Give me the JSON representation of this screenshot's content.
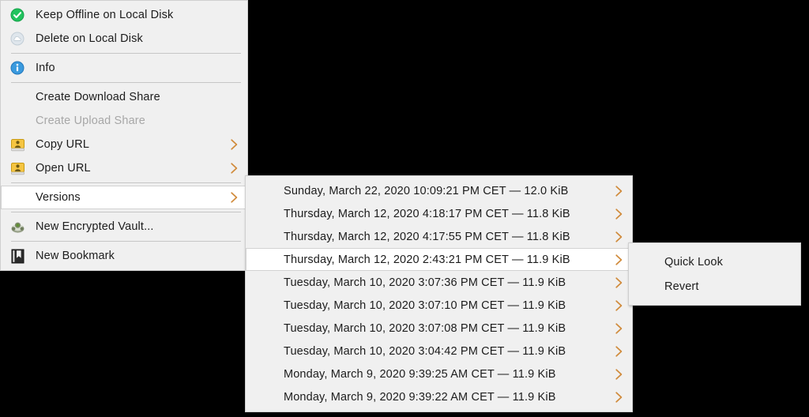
{
  "colors": {
    "menu_background": "#f0f0f0",
    "menu_border": "#cfcfcf",
    "highlight_background": "#ffffff",
    "text": "#1c1c1c",
    "disabled_text": "#a7a7a7",
    "separator": "#c6c6c6",
    "chevron": "#d08a3a",
    "check_green": "#22c35e",
    "info_blue": "#3a9ade",
    "share_yellow": "#f5c542",
    "desktop": "#000000"
  },
  "main_menu": {
    "items": [
      {
        "label": "Keep Offline on Local Disk",
        "icon": "green-check-icon",
        "type": "item",
        "disabled": false,
        "submenu": false,
        "highlighted": false
      },
      {
        "label": "Delete on Local Disk",
        "icon": "cloud-icon",
        "type": "item",
        "disabled": false,
        "submenu": false,
        "highlighted": false
      },
      {
        "type": "separator"
      },
      {
        "label": "Info",
        "icon": "info-icon",
        "type": "item",
        "disabled": false,
        "submenu": false,
        "highlighted": false
      },
      {
        "type": "separator"
      },
      {
        "label": "Create Download Share",
        "icon": "none",
        "type": "item",
        "disabled": false,
        "submenu": false,
        "highlighted": false
      },
      {
        "label": "Create Upload Share",
        "icon": "none",
        "type": "item",
        "disabled": true,
        "submenu": false,
        "highlighted": false
      },
      {
        "label": "Copy URL",
        "icon": "share-disk-icon",
        "type": "item",
        "disabled": false,
        "submenu": true,
        "highlighted": false
      },
      {
        "label": "Open URL",
        "icon": "share-disk-icon",
        "type": "item",
        "disabled": false,
        "submenu": true,
        "highlighted": false
      },
      {
        "type": "separator"
      },
      {
        "label": "Versions",
        "icon": "none",
        "type": "item",
        "disabled": false,
        "submenu": true,
        "highlighted": true
      },
      {
        "type": "separator"
      },
      {
        "label": "New Encrypted Vault...",
        "icon": "vault-icon",
        "type": "item",
        "disabled": false,
        "submenu": false,
        "highlighted": false
      },
      {
        "type": "separator"
      },
      {
        "label": "New Bookmark",
        "icon": "bookmark-icon",
        "type": "item",
        "disabled": false,
        "submenu": false,
        "highlighted": false
      }
    ]
  },
  "versions_menu": {
    "items": [
      {
        "label": "Sunday, March 22, 2020 10:09:21 PM CET — 12.0 KiB",
        "submenu": true,
        "highlighted": false
      },
      {
        "label": "Thursday, March 12, 2020 4:18:17 PM CET — 11.8 KiB",
        "submenu": true,
        "highlighted": false
      },
      {
        "label": "Thursday, March 12, 2020 4:17:55 PM CET — 11.8 KiB",
        "submenu": true,
        "highlighted": false
      },
      {
        "label": "Thursday, March 12, 2020 2:43:21 PM CET — 11.9 KiB",
        "submenu": true,
        "highlighted": true
      },
      {
        "label": "Tuesday, March 10, 2020 3:07:36 PM CET — 11.9 KiB",
        "submenu": true,
        "highlighted": false
      },
      {
        "label": "Tuesday, March 10, 2020 3:07:10 PM CET — 11.9 KiB",
        "submenu": true,
        "highlighted": false
      },
      {
        "label": "Tuesday, March 10, 2020 3:07:08 PM CET — 11.9 KiB",
        "submenu": true,
        "highlighted": false
      },
      {
        "label": "Tuesday, March 10, 2020 3:04:42 PM CET — 11.9 KiB",
        "submenu": true,
        "highlighted": false
      },
      {
        "label": "Monday, March 9, 2020 9:39:25 AM CET — 11.9 KiB",
        "submenu": true,
        "highlighted": false
      },
      {
        "label": "Monday, March 9, 2020 9:39:22 AM CET — 11.9 KiB",
        "submenu": true,
        "highlighted": false
      }
    ]
  },
  "action_menu": {
    "items": [
      {
        "label": "Quick Look",
        "submenu": false,
        "highlighted": false
      },
      {
        "label": "Revert",
        "submenu": false,
        "highlighted": false
      }
    ]
  }
}
